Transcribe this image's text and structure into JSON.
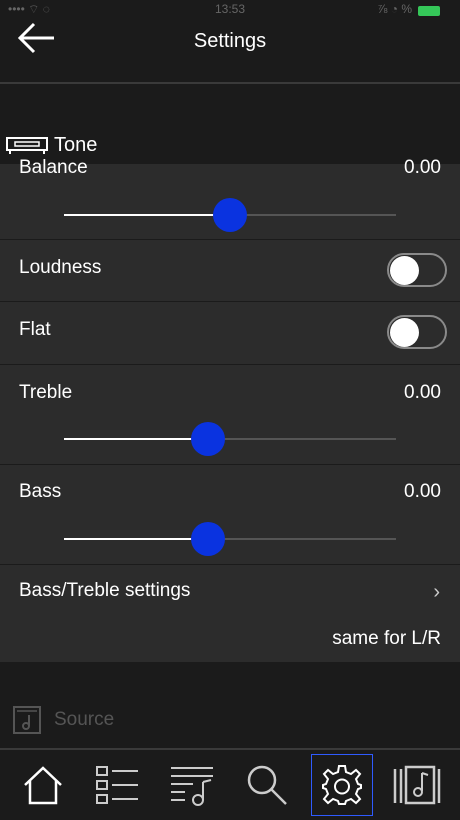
{
  "statusbar": {
    "left": "•••• ⌔ ◌",
    "time": "13:53",
    "right": "⅞ ◔ %"
  },
  "navbar": {
    "title": "Settings"
  },
  "section": {
    "label": "Tone"
  },
  "balance": {
    "label": "Balance",
    "value": "0.00",
    "level": 0.5
  },
  "loudness": {
    "label": "Loudness",
    "on": false
  },
  "flat": {
    "label": "Flat",
    "on": false
  },
  "treble": {
    "label": "Treble",
    "value": "0.00",
    "level": 0.435
  },
  "bass": {
    "label": "Bass",
    "value": "0.00",
    "level": 0.435
  },
  "bass_treble": {
    "label": "Bass/Treble settings",
    "sub": "same for L/R"
  },
  "source": {
    "label": "Source"
  },
  "tabs": [
    "home-icon",
    "list-icon",
    "playlist-icon",
    "search-icon",
    "settings-icon",
    "library-icon"
  ],
  "colors": {
    "accent": "#0a33e0",
    "active_border": "#2f5bff"
  }
}
